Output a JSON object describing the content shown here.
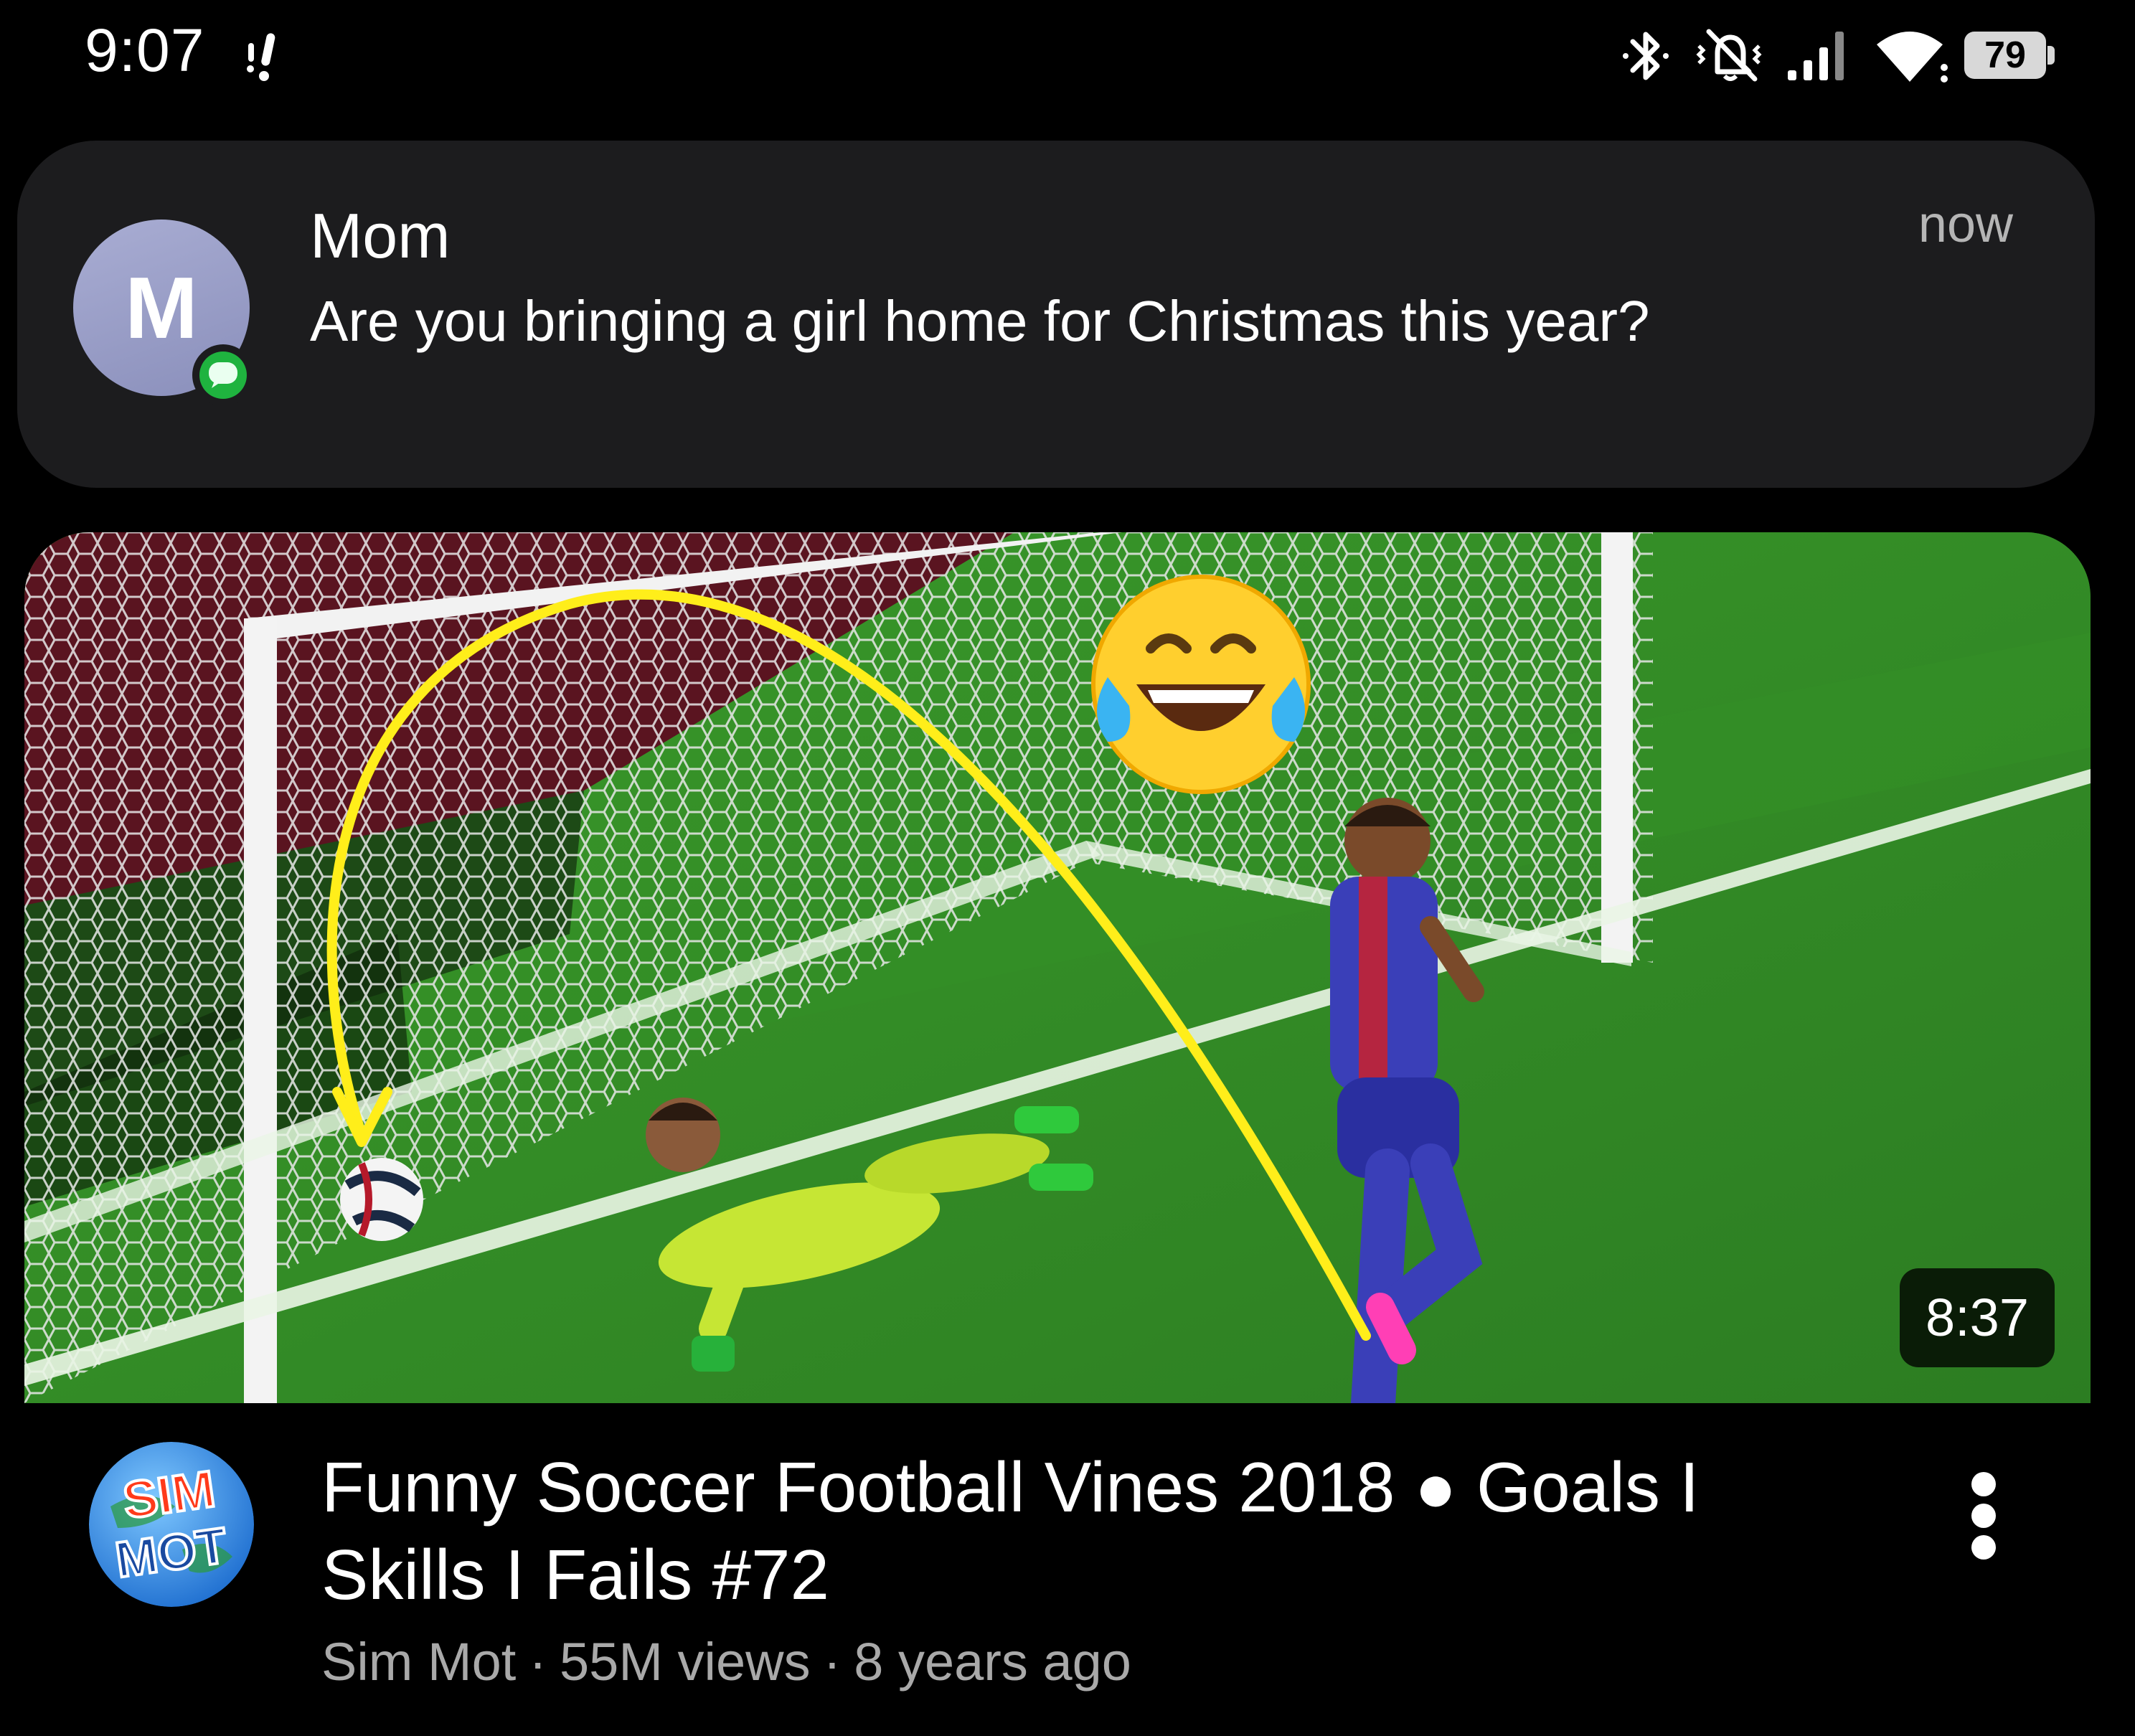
{
  "status_bar": {
    "time": "9:07",
    "battery_level": "79",
    "icons": [
      "notification-alert-icon",
      "bluetooth-icon",
      "vibrate-off-icon",
      "cellular-signal-icon",
      "wifi-icon",
      "battery-icon"
    ]
  },
  "notification": {
    "avatar_initial": "M",
    "sender": "Mom",
    "message": "Are you bringing a girl home for Christmas this year?",
    "time": "now",
    "app_badge_icon": "messages-icon",
    "badge_color": "#1fb33f"
  },
  "video": {
    "duration": "8:37",
    "title": "Funny Soccer Football Vines 2018 ● Goals I Skills I Fails #72",
    "channel": "Sim Mot",
    "views": "55M views",
    "age": "8 years ago",
    "separator": "·",
    "channel_logo_text": [
      "SIM",
      "MOT"
    ],
    "thumbnail_emoji": "face-with-tears-of-joy-icon"
  }
}
